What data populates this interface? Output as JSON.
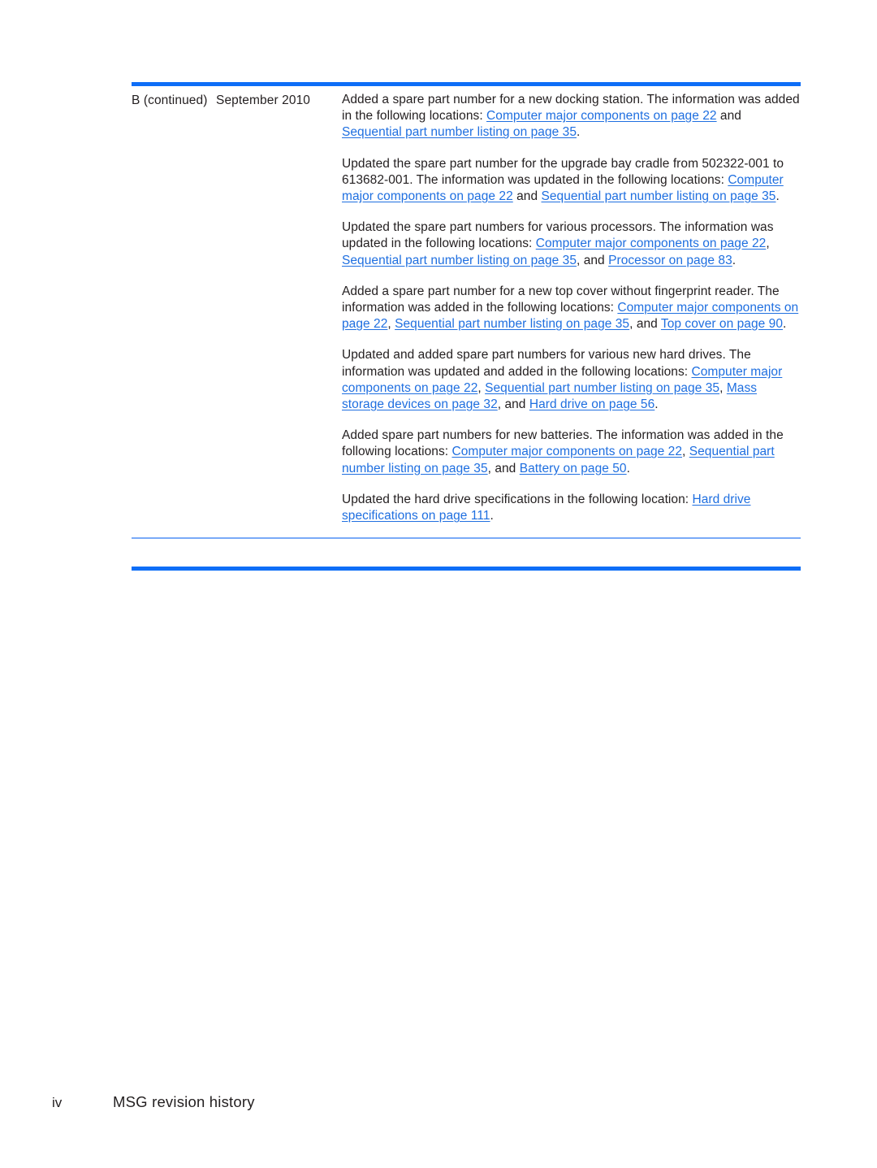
{
  "document": {
    "footer": {
      "page_number": "iv",
      "title": "MSG revision history"
    }
  },
  "colors": {
    "rule_primary": "#0e6ef7",
    "rule_secondary": "#7aaaf7",
    "link": "#1f6fe0",
    "text": "#231f20"
  },
  "table": {
    "row": {
      "revision": "B (continued)",
      "date": "September 2010",
      "description_paragraphs": [
        {
          "id": "docking-station",
          "segments": [
            {
              "type": "text",
              "value": "Added a spare part number for a new docking station. The information was added in the following locations: "
            },
            {
              "type": "link",
              "value": "Computer major components on page 22"
            },
            {
              "type": "text",
              "value": " and "
            },
            {
              "type": "link",
              "value": "Sequential part number listing on page 35"
            },
            {
              "type": "text",
              "value": "."
            }
          ]
        },
        {
          "id": "upgrade-bay-cradle",
          "segments": [
            {
              "type": "text",
              "value": "Updated the spare part number for the upgrade bay cradle from 502322-001 to 613682-001. The information was updated in the following locations: "
            },
            {
              "type": "link",
              "value": "Computer major components on page 22"
            },
            {
              "type": "text",
              "value": " and "
            },
            {
              "type": "link",
              "value": "Sequential part number listing on page 35"
            },
            {
              "type": "text",
              "value": "."
            }
          ]
        },
        {
          "id": "processors",
          "segments": [
            {
              "type": "text",
              "value": "Updated the spare part numbers for various processors. The information was updated in the following locations: "
            },
            {
              "type": "link",
              "value": "Computer major components on page 22"
            },
            {
              "type": "text",
              "value": ", "
            },
            {
              "type": "link",
              "value": "Sequential part number listing on page 35"
            },
            {
              "type": "text",
              "value": ", and "
            },
            {
              "type": "link",
              "value": "Processor on page 83"
            },
            {
              "type": "text",
              "value": "."
            }
          ]
        },
        {
          "id": "top-cover",
          "segments": [
            {
              "type": "text",
              "value": "Added a spare part number for a new top cover without fingerprint reader. The information was added in the following locations: "
            },
            {
              "type": "link",
              "value": "Computer major components on page 22"
            },
            {
              "type": "text",
              "value": ", "
            },
            {
              "type": "link",
              "value": "Sequential part number listing on page 35"
            },
            {
              "type": "text",
              "value": ", and "
            },
            {
              "type": "link",
              "value": "Top cover on page 90"
            },
            {
              "type": "text",
              "value": "."
            }
          ]
        },
        {
          "id": "hard-drives",
          "segments": [
            {
              "type": "text",
              "value": "Updated and added spare part numbers for various new hard drives. The information was updated and added in the following locations: "
            },
            {
              "type": "link",
              "value": "Computer major components on page 22"
            },
            {
              "type": "text",
              "value": ", "
            },
            {
              "type": "link",
              "value": "Sequential part number listing on page 35"
            },
            {
              "type": "text",
              "value": ", "
            },
            {
              "type": "link",
              "value": "Mass storage devices on page 32"
            },
            {
              "type": "text",
              "value": ", and "
            },
            {
              "type": "link",
              "value": "Hard drive on page 56"
            },
            {
              "type": "text",
              "value": "."
            }
          ]
        },
        {
          "id": "batteries",
          "segments": [
            {
              "type": "text",
              "value": "Added spare part numbers for new batteries. The information was added in the following locations: "
            },
            {
              "type": "link",
              "value": "Computer major components on page 22"
            },
            {
              "type": "text",
              "value": ", "
            },
            {
              "type": "link",
              "value": "Sequential part number listing on page 35"
            },
            {
              "type": "text",
              "value": ", and "
            },
            {
              "type": "link",
              "value": "Battery on page 50"
            },
            {
              "type": "text",
              "value": "."
            }
          ]
        },
        {
          "id": "hard-drive-specs",
          "segments": [
            {
              "type": "text",
              "value": "Updated the hard drive specifications in the following location: "
            },
            {
              "type": "link",
              "value": "Hard drive specifications on page 111"
            },
            {
              "type": "text",
              "value": "."
            }
          ]
        }
      ]
    }
  }
}
